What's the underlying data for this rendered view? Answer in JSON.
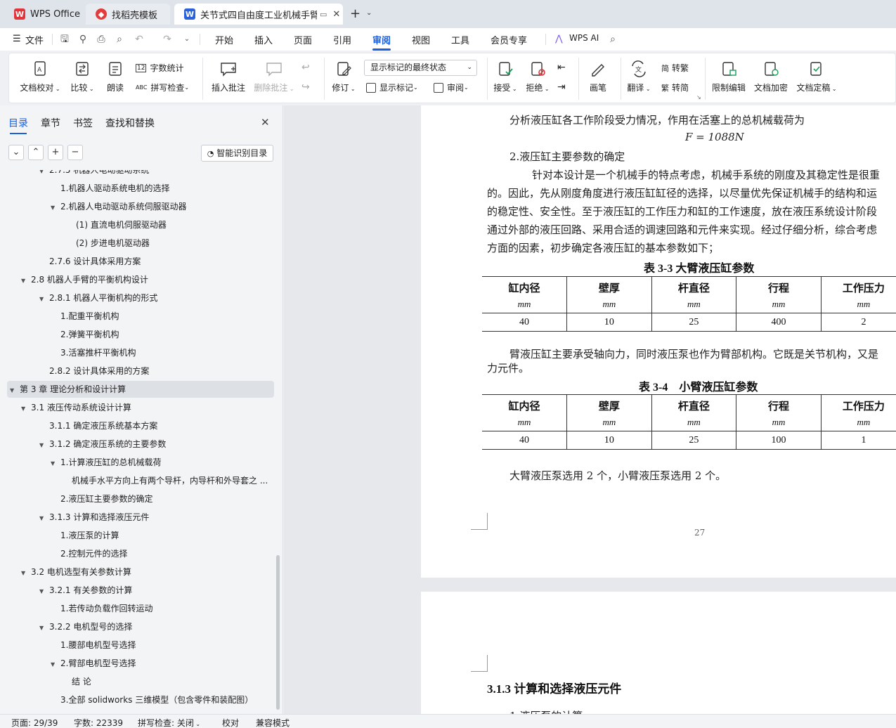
{
  "tabs": [
    {
      "label": "WPS Office",
      "icon": "wps-logo-icon"
    },
    {
      "label": "找稻壳模板",
      "icon": "docer-icon"
    },
    {
      "label": "关节式四自由度工业机械手臂",
      "icon": "word-doc-icon"
    }
  ],
  "menu": {
    "file": "文件",
    "items": [
      "开始",
      "插入",
      "页面",
      "引用",
      "审阅",
      "视图",
      "工具",
      "会员专享"
    ],
    "active": "审阅",
    "ai": "WPS AI"
  },
  "ribbon": {
    "doc_check": "文档校对",
    "compare": "比较",
    "read_aloud": "朗读",
    "word_count": "字数统计",
    "spell_check": "拼写检查",
    "insert_comment": "插入批注",
    "delete_comment": "删除批注",
    "revise": "修订",
    "markup_state": "显示标记的最终状态",
    "show_markup": "显示标记",
    "review": "审阅",
    "accept": "接受",
    "reject": "拒绝",
    "pen": "画笔",
    "translate": "翻译",
    "to_traditional": "转繁",
    "to_simplified": "转简",
    "restrict_edit": "限制编辑",
    "encrypt": "文档加密",
    "finalize": "文档定稿"
  },
  "sidebar": {
    "tabs": [
      "目录",
      "章节",
      "书签",
      "查找和替换"
    ],
    "active_tab": "目录",
    "ai_toc": "智能识别目录",
    "toc": [
      {
        "text": "2.7.5 机器人电动驱动系统",
        "indent": 3,
        "arrow": "▼"
      },
      {
        "text": "1.机器人驱动系统电机的选择",
        "indent": 4,
        "arrow": ""
      },
      {
        "text": "2.机器人电动驱动系统伺服驱动器",
        "indent": 4,
        "arrow": "▼"
      },
      {
        "text": "(1) 直流电机伺服驱动器",
        "indent": 6,
        "arrow": ""
      },
      {
        "text": "(2) 步进电机驱动器",
        "indent": 6,
        "arrow": ""
      },
      {
        "text": "2.7.6 设计具体采用方案",
        "indent": 3,
        "arrow": ""
      },
      {
        "text": "2.8  机器人手臂的平衡机构设计",
        "indent": 2,
        "arrow": "▼"
      },
      {
        "text": "2.8.1 机器人平衡机构的形式",
        "indent": 3,
        "arrow": "▼"
      },
      {
        "text": "1.配重平衡机构",
        "indent": 4,
        "arrow": ""
      },
      {
        "text": "2.弹簧平衡机构",
        "indent": 4,
        "arrow": ""
      },
      {
        "text": "3.活塞推杆平衡机构",
        "indent": 4,
        "arrow": ""
      },
      {
        "text": "2.8.2 设计具体采用的方案",
        "indent": 3,
        "arrow": ""
      },
      {
        "text": "第 3 章  理论分析和设计计算",
        "indent": 1,
        "arrow": "▼",
        "selected": true
      },
      {
        "text": "3.1 液压传动系统设计计算",
        "indent": 2,
        "arrow": "▼"
      },
      {
        "text": "3.1.1 确定液压系统基本方案",
        "indent": 3,
        "arrow": ""
      },
      {
        "text": "3.1.2 确定液压系统的主要参数",
        "indent": 3,
        "arrow": "▼"
      },
      {
        "text": "1.计算液压缸的总机械载荷",
        "indent": 4,
        "arrow": "▼"
      },
      {
        "text": "机械手水平方向上有两个导杆，内导杆和外导套之 ...",
        "indent": 5,
        "arrow": ""
      },
      {
        "text": "2.液压缸主要参数的确定",
        "indent": 4,
        "arrow": ""
      },
      {
        "text": "3.1.3 计算和选择液压元件",
        "indent": 3,
        "arrow": "▼"
      },
      {
        "text": "1.液压泵的计算",
        "indent": 4,
        "arrow": ""
      },
      {
        "text": "2.控制元件的选择",
        "indent": 4,
        "arrow": ""
      },
      {
        "text": "3.2  电机选型有关参数计算",
        "indent": 2,
        "arrow": "▼"
      },
      {
        "text": "3.2.1 有关参数的计算",
        "indent": 3,
        "arrow": "▼"
      },
      {
        "text": "1.若传动负载作回转运动",
        "indent": 4,
        "arrow": ""
      },
      {
        "text": "3.2.2 电机型号的选择",
        "indent": 3,
        "arrow": "▼"
      },
      {
        "text": "1.腰部电机型号选择",
        "indent": 4,
        "arrow": ""
      },
      {
        "text": "2.臂部电机型号选择",
        "indent": 4,
        "arrow": "▼"
      },
      {
        "text": "结  论",
        "indent": 5,
        "arrow": ""
      },
      {
        "text": "3.全部 solidworks 三维模型（包含零件和装配图）",
        "indent": 4,
        "arrow": ""
      }
    ]
  },
  "doc": {
    "p1": "分析液压缸各工作阶段受力情况，作用在活塞上的总机械载荷为",
    "formula": "F = 1088N",
    "p2": "2.液压缸主要参数的确定",
    "p3_lines": [
      "针对本设计是一个机械手的特点考虑，机械手系统的刚度及其稳定性是很重",
      "的。因此，先从刚度角度进行液压缸缸径的选择，以尽量优先保证机械手的结构和运",
      "的稳定性、安全性。至于液压缸的工作压力和缸的工作速度，放在液压系统设计阶段",
      "通过外部的液压回路、采用合适的调速回路和元件来实现。经过仔细分析，综合考虑",
      "方面的因素，初步确定各液压缸的基本参数如下；"
    ],
    "table1": {
      "caption": "表 3-3 大臂液压缸参数",
      "headers": [
        "缸内径",
        "壁厚",
        "杆直径",
        "行程",
        "工作压力"
      ],
      "units": [
        "mm",
        "mm",
        "mm",
        "mm",
        "mm"
      ],
      "values": [
        "40",
        "10",
        "25",
        "400",
        "2"
      ]
    },
    "p4_lines": [
      "臂液压缸主要承受轴向力，同时液压泵也作为臂部机构。它既是关节机构，又是",
      "力元件。"
    ],
    "table2": {
      "caption": "表 3-4　小臂液压缸参数",
      "headers": [
        "缸内径",
        "壁厚",
        "杆直径",
        "行程",
        "工作压力"
      ],
      "units": [
        "mm",
        "mm",
        "mm",
        "mm",
        "mm"
      ],
      "values": [
        "40",
        "10",
        "25",
        "100",
        "1"
      ]
    },
    "p5": "大臂液压泵选用 2 个，小臂液压泵选用 2 个。",
    "page_number": "27",
    "next_heading": "3.1.3 计算和选择液压元件",
    "next_line": "1.液压泵的计算"
  },
  "status": {
    "page": "页面: 29/39",
    "words": "字数: 22339",
    "spell": "拼写检查: 关闭",
    "proof": "校对",
    "compat": "兼容模式"
  }
}
